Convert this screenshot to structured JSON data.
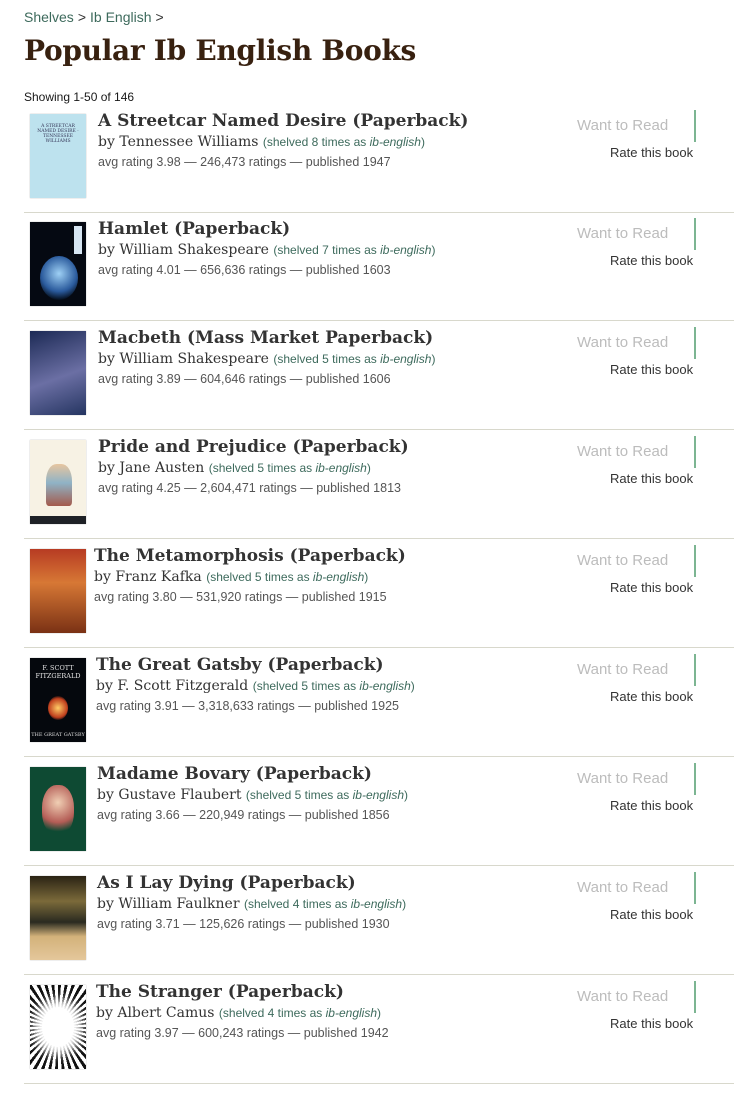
{
  "breadcrumb": {
    "shelves": "Shelves",
    "sep1": ">",
    "current": "Ib English",
    "sep2": ">"
  },
  "page_title": "Popular Ib English Books",
  "showing": "Showing 1-50 of 146",
  "actions": {
    "want_to_read": "Want to Read",
    "rate": "Rate this book",
    "accent_color": "#7cb592"
  },
  "books": [
    {
      "title": "A Streetcar Named Desire (Paperback)",
      "by": "by",
      "author": "Tennessee Williams",
      "shelved_pre": "(shelved 8 times as ",
      "shelved_tag": "ib-english",
      "shelved_post": ")",
      "meta": "avg rating 3.98 — 246,473 ratings — published 1947",
      "cover_icon": "book-cover-streetcar"
    },
    {
      "title": "Hamlet (Paperback)",
      "by": "by",
      "author": "William Shakespeare",
      "shelved_pre": "(shelved 7 times as ",
      "shelved_tag": "ib-english",
      "shelved_post": ")",
      "meta": "avg rating 4.01 — 656,636 ratings — published 1603",
      "cover_icon": "book-cover-hamlet"
    },
    {
      "title": "Macbeth (Mass Market Paperback)",
      "by": "by",
      "author": "William Shakespeare",
      "shelved_pre": "(shelved 5 times as ",
      "shelved_tag": "ib-english",
      "shelved_post": ")",
      "meta": "avg rating 3.89 — 604,646 ratings — published 1606",
      "cover_icon": "book-cover-macbeth"
    },
    {
      "title": "Pride and Prejudice (Paperback)",
      "by": "by",
      "author": "Jane Austen",
      "shelved_pre": "(shelved 5 times as ",
      "shelved_tag": "ib-english",
      "shelved_post": ")",
      "meta": "avg rating 4.25 — 2,604,471 ratings — published 1813",
      "cover_icon": "book-cover-pride"
    },
    {
      "title": "The Metamorphosis (Paperback)",
      "by": "by",
      "author": "Franz Kafka",
      "shelved_pre": "(shelved 5 times as ",
      "shelved_tag": "ib-english",
      "shelved_post": ")",
      "meta": "avg rating 3.80 — 531,920 ratings — published 1915",
      "cover_icon": "book-cover-metamorphosis"
    },
    {
      "title": "The Great Gatsby (Paperback)",
      "by": "by",
      "author": "F. Scott Fitzgerald",
      "shelved_pre": "(shelved 5 times as ",
      "shelved_tag": "ib-english",
      "shelved_post": ")",
      "meta": "avg rating 3.91 — 3,318,633 ratings — published 1925",
      "cover_icon": "book-cover-gatsby"
    },
    {
      "title": "Madame Bovary (Paperback)",
      "by": "by",
      "author": "Gustave Flaubert",
      "shelved_pre": "(shelved 5 times as ",
      "shelved_tag": "ib-english",
      "shelved_post": ")",
      "meta": "avg rating 3.66 — 220,949 ratings — published 1856",
      "cover_icon": "book-cover-bovary"
    },
    {
      "title": "As I Lay Dying (Paperback)",
      "by": "by",
      "author": "William Faulkner",
      "shelved_pre": "(shelved 4 times as ",
      "shelved_tag": "ib-english",
      "shelved_post": ")",
      "meta": "avg rating 3.71 — 125,626 ratings — published 1930",
      "cover_icon": "book-cover-as-i-lay-dying"
    },
    {
      "title": "The Stranger (Paperback)",
      "by": "by",
      "author": "Albert Camus",
      "shelved_pre": "(shelved 4 times as ",
      "shelved_tag": "ib-english",
      "shelved_post": ")",
      "meta": "avg rating 3.97 — 600,243 ratings — published 1942",
      "cover_icon": "book-cover-stranger"
    }
  ],
  "cover_text": {
    "streetcar": "A STREETCAR NAMED DESIRE · TENNESSEE WILLIAMS",
    "gatsby_top": "F. SCOTT FITZGERALD",
    "gatsby_bottom": "THE GREAT GATSBY"
  }
}
